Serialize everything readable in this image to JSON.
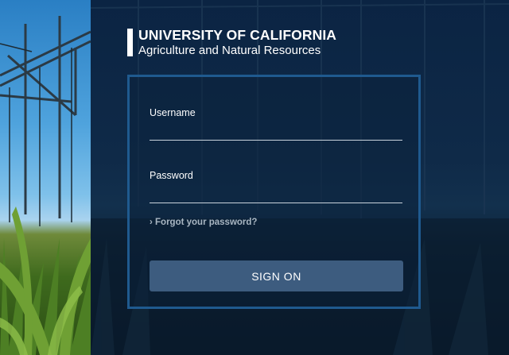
{
  "logo": {
    "title": "UNIVERSITY OF CALIFORNIA",
    "subtitle": "Agriculture and Natural Resources"
  },
  "login": {
    "username_label": "Username",
    "username_value": "",
    "password_label": "Password",
    "password_value": "",
    "forgot_link": "› Forgot your password?",
    "signon_label": "SIGN ON"
  },
  "colors": {
    "box_border": "#1f5a8f",
    "button_bg": "#3d5c7f",
    "background": "#0c1e33"
  }
}
